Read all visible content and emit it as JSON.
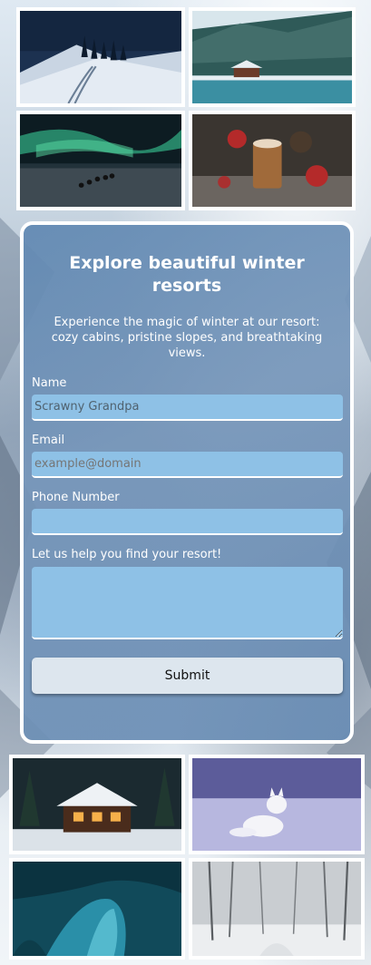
{
  "top_gallery": [
    {
      "alt": "snowy hill with ski tracks at night"
    },
    {
      "alt": "cabin by a frozen lake with snowy forest"
    },
    {
      "alt": "northern lights over dog sled"
    },
    {
      "alt": "hot chocolate with winter decorations"
    }
  ],
  "form": {
    "title": "Explore beautiful winter resorts",
    "subtitle": "Experience the magic of winter at our resort: cozy cabins, pristine slopes, and breathtaking views.",
    "name_label": "Name",
    "name_value": "Scrawny Grandpa",
    "email_label": "Email",
    "email_placeholder": "example@domain",
    "phone_label": "Phone Number",
    "message_label": "Let us help you find your resort!",
    "submit_label": "Submit"
  },
  "bottom_gallery": [
    {
      "alt": "lit cabin in snowy woods"
    },
    {
      "alt": "arctic fox in snow"
    },
    {
      "alt": "blue ice cave"
    },
    {
      "alt": "snowy forest path"
    }
  ],
  "colors": {
    "card_bg": "#6c95c0",
    "field_bg": "#8ec1e6",
    "button_bg": "#dde6ee",
    "border": "#ffffff"
  }
}
